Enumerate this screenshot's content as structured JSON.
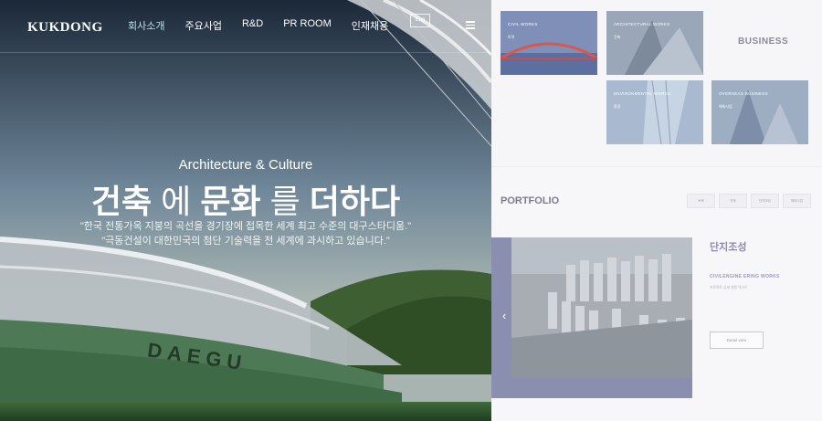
{
  "header": {
    "logo": "KUKDONG",
    "nav": [
      {
        "label": "회사소개",
        "active": true
      },
      {
        "label": "주요사업",
        "active": false
      },
      {
        "label": "R&D",
        "active": false
      },
      {
        "label": "PR ROOM",
        "active": false
      },
      {
        "label": "인재채용",
        "active": false
      }
    ],
    "lang_label": "Eng",
    "menu_icon": "hamburger-icon"
  },
  "hero": {
    "subtitle": "Architecture & Culture",
    "title_part1": "건축",
    "title_part2": "에",
    "title_part3": "문화",
    "title_part4": "를",
    "title_part5": "더하다",
    "desc_line1": "\"한국 전통가옥 지붕의 곡선을 경기장에 접목한 세계 최고 수준의 대구스타디움.\"",
    "desc_line2": "\"극동건설이 대한민국의 첨단 기술력을 전 세계에 과시하고 있습니다.\"",
    "stadium_text": "DAEGU"
  },
  "business": {
    "title": "BUSINESS",
    "cards": [
      {
        "label": "CIVIL WORKS",
        "sub": "토목"
      },
      {
        "label": "ARCHITECTURAL WORKS",
        "sub": "건축"
      },
      {
        "label": "ENVIRONMENTAL WORKS",
        "sub": "환경"
      },
      {
        "label": "OVERSEAS BUSINESS",
        "sub": "해외사업"
      }
    ]
  },
  "portfolio": {
    "title": "PORTFOLIO",
    "tabs": [
      "토목",
      "건축",
      "단지조성",
      "해외사업"
    ],
    "project_title": "단지조성",
    "project_category": "CIVILENGINE ERING WORKS",
    "project_desc": "프로젝트 상세 설명 텍스트",
    "detail_button": "Detail view",
    "prev_arrow": "‹"
  },
  "colors": {
    "accent": "#8a8fb0",
    "nav_active": "#b9e0e8"
  }
}
